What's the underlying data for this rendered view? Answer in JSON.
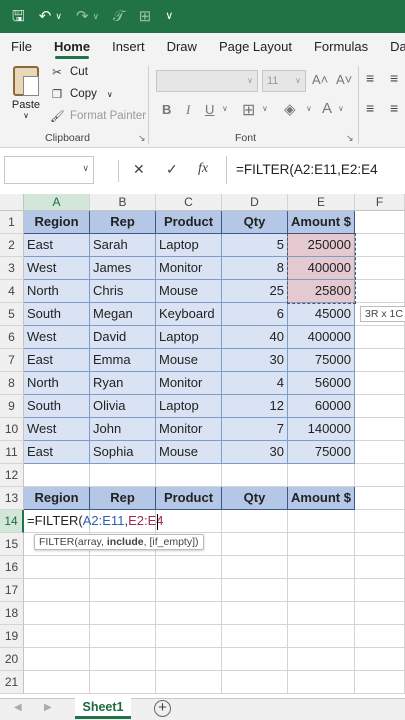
{
  "ribbon": {
    "tabs": [
      "File",
      "Home",
      "Insert",
      "Draw",
      "Page Layout",
      "Formulas",
      "Data"
    ],
    "active_tab": "Home",
    "clipboard": {
      "paste": "Paste",
      "cut": "Cut",
      "copy": "Copy",
      "format_painter": "Format Painter",
      "group_label": "Clipboard"
    },
    "font": {
      "size": "11",
      "group_label": "Font",
      "grow_icon": "A˄",
      "shrink_icon": "A˅",
      "bold": "B",
      "italic": "I",
      "underline": "U"
    }
  },
  "formula_bar": {
    "name_box": "",
    "cancel": "✕",
    "enter": "✓",
    "fx": "fx",
    "formula": "=FILTER(A2:E11,E2:E4"
  },
  "sheet": {
    "columns": [
      "A",
      "B",
      "C",
      "D",
      "E",
      "F"
    ],
    "rows": [
      "1",
      "2",
      "3",
      "4",
      "5",
      "6",
      "7",
      "8",
      "9",
      "10",
      "11",
      "12",
      "13",
      "14",
      "15",
      "16",
      "17",
      "18",
      "19",
      "20",
      "21"
    ],
    "headers": [
      "Region",
      "Rep",
      "Product",
      "Qty",
      "Amount $"
    ],
    "data": [
      [
        "East",
        "Sarah",
        "Laptop",
        "5",
        "250000"
      ],
      [
        "West",
        "James",
        "Monitor",
        "8",
        "400000"
      ],
      [
        "North",
        "Chris",
        "Mouse",
        "25",
        "25800"
      ],
      [
        "South",
        "Megan",
        "Keyboard",
        "6",
        "45000"
      ],
      [
        "West",
        "David",
        "Laptop",
        "40",
        "400000"
      ],
      [
        "East",
        "Emma",
        "Mouse",
        "30",
        "75000"
      ],
      [
        "North",
        "Ryan",
        "Monitor",
        "4",
        "56000"
      ],
      [
        "South",
        "Olivia",
        "Laptop",
        "12",
        "60000"
      ],
      [
        "West",
        "John",
        "Monitor",
        "7",
        "140000"
      ],
      [
        "East",
        "Sophia",
        "Mouse",
        "30",
        "75000"
      ]
    ],
    "output_headers": [
      "Region",
      "Rep",
      "Product",
      "Qty",
      "Amount $"
    ],
    "editing": {
      "prefix": "=FILTER(",
      "ref1": "A2:E11",
      "comma": ",",
      "ref2": "E2:E4"
    },
    "selection_tooltip": "3R x 1C",
    "function_tooltip": {
      "prefix": "FILTER(array, ",
      "bold": "include",
      "suffix": ", [if_empty])"
    },
    "active_sheet": "Sheet1",
    "add_sheet": "+"
  },
  "colors": {
    "accent": "#217346",
    "table_header": "#b4c7e7",
    "table_body": "#dae3f3",
    "highlight": "#e4c9d0"
  }
}
